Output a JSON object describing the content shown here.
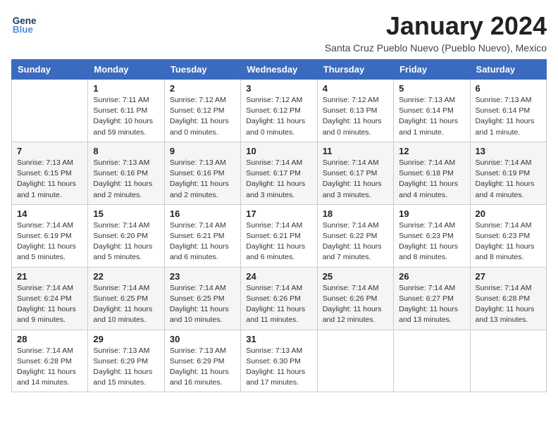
{
  "logo": {
    "line1": "General",
    "line2": "Blue"
  },
  "title": "January 2024",
  "subtitle": "Santa Cruz Pueblo Nuevo (Pueblo Nuevo), Mexico",
  "days_of_week": [
    "Sunday",
    "Monday",
    "Tuesday",
    "Wednesday",
    "Thursday",
    "Friday",
    "Saturday"
  ],
  "weeks": [
    [
      {
        "day": "",
        "info": ""
      },
      {
        "day": "1",
        "info": "Sunrise: 7:11 AM\nSunset: 6:11 PM\nDaylight: 10 hours\nand 59 minutes."
      },
      {
        "day": "2",
        "info": "Sunrise: 7:12 AM\nSunset: 6:12 PM\nDaylight: 11 hours\nand 0 minutes."
      },
      {
        "day": "3",
        "info": "Sunrise: 7:12 AM\nSunset: 6:12 PM\nDaylight: 11 hours\nand 0 minutes."
      },
      {
        "day": "4",
        "info": "Sunrise: 7:12 AM\nSunset: 6:13 PM\nDaylight: 11 hours\nand 0 minutes."
      },
      {
        "day": "5",
        "info": "Sunrise: 7:13 AM\nSunset: 6:14 PM\nDaylight: 11 hours\nand 1 minute."
      },
      {
        "day": "6",
        "info": "Sunrise: 7:13 AM\nSunset: 6:14 PM\nDaylight: 11 hours\nand 1 minute."
      }
    ],
    [
      {
        "day": "7",
        "info": "Sunrise: 7:13 AM\nSunset: 6:15 PM\nDaylight: 11 hours\nand 1 minute."
      },
      {
        "day": "8",
        "info": "Sunrise: 7:13 AM\nSunset: 6:16 PM\nDaylight: 11 hours\nand 2 minutes."
      },
      {
        "day": "9",
        "info": "Sunrise: 7:13 AM\nSunset: 6:16 PM\nDaylight: 11 hours\nand 2 minutes."
      },
      {
        "day": "10",
        "info": "Sunrise: 7:14 AM\nSunset: 6:17 PM\nDaylight: 11 hours\nand 3 minutes."
      },
      {
        "day": "11",
        "info": "Sunrise: 7:14 AM\nSunset: 6:17 PM\nDaylight: 11 hours\nand 3 minutes."
      },
      {
        "day": "12",
        "info": "Sunrise: 7:14 AM\nSunset: 6:18 PM\nDaylight: 11 hours\nand 4 minutes."
      },
      {
        "day": "13",
        "info": "Sunrise: 7:14 AM\nSunset: 6:19 PM\nDaylight: 11 hours\nand 4 minutes."
      }
    ],
    [
      {
        "day": "14",
        "info": "Sunrise: 7:14 AM\nSunset: 6:19 PM\nDaylight: 11 hours\nand 5 minutes."
      },
      {
        "day": "15",
        "info": "Sunrise: 7:14 AM\nSunset: 6:20 PM\nDaylight: 11 hours\nand 5 minutes."
      },
      {
        "day": "16",
        "info": "Sunrise: 7:14 AM\nSunset: 6:21 PM\nDaylight: 11 hours\nand 6 minutes."
      },
      {
        "day": "17",
        "info": "Sunrise: 7:14 AM\nSunset: 6:21 PM\nDaylight: 11 hours\nand 6 minutes."
      },
      {
        "day": "18",
        "info": "Sunrise: 7:14 AM\nSunset: 6:22 PM\nDaylight: 11 hours\nand 7 minutes."
      },
      {
        "day": "19",
        "info": "Sunrise: 7:14 AM\nSunset: 6:23 PM\nDaylight: 11 hours\nand 8 minutes."
      },
      {
        "day": "20",
        "info": "Sunrise: 7:14 AM\nSunset: 6:23 PM\nDaylight: 11 hours\nand 8 minutes."
      }
    ],
    [
      {
        "day": "21",
        "info": "Sunrise: 7:14 AM\nSunset: 6:24 PM\nDaylight: 11 hours\nand 9 minutes."
      },
      {
        "day": "22",
        "info": "Sunrise: 7:14 AM\nSunset: 6:25 PM\nDaylight: 11 hours\nand 10 minutes."
      },
      {
        "day": "23",
        "info": "Sunrise: 7:14 AM\nSunset: 6:25 PM\nDaylight: 11 hours\nand 10 minutes."
      },
      {
        "day": "24",
        "info": "Sunrise: 7:14 AM\nSunset: 6:26 PM\nDaylight: 11 hours\nand 11 minutes."
      },
      {
        "day": "25",
        "info": "Sunrise: 7:14 AM\nSunset: 6:26 PM\nDaylight: 11 hours\nand 12 minutes."
      },
      {
        "day": "26",
        "info": "Sunrise: 7:14 AM\nSunset: 6:27 PM\nDaylight: 11 hours\nand 13 minutes."
      },
      {
        "day": "27",
        "info": "Sunrise: 7:14 AM\nSunset: 6:28 PM\nDaylight: 11 hours\nand 13 minutes."
      }
    ],
    [
      {
        "day": "28",
        "info": "Sunrise: 7:14 AM\nSunset: 6:28 PM\nDaylight: 11 hours\nand 14 minutes."
      },
      {
        "day": "29",
        "info": "Sunrise: 7:13 AM\nSunset: 6:29 PM\nDaylight: 11 hours\nand 15 minutes."
      },
      {
        "day": "30",
        "info": "Sunrise: 7:13 AM\nSunset: 6:29 PM\nDaylight: 11 hours\nand 16 minutes."
      },
      {
        "day": "31",
        "info": "Sunrise: 7:13 AM\nSunset: 6:30 PM\nDaylight: 11 hours\nand 17 minutes."
      },
      {
        "day": "",
        "info": ""
      },
      {
        "day": "",
        "info": ""
      },
      {
        "day": "",
        "info": ""
      }
    ]
  ]
}
